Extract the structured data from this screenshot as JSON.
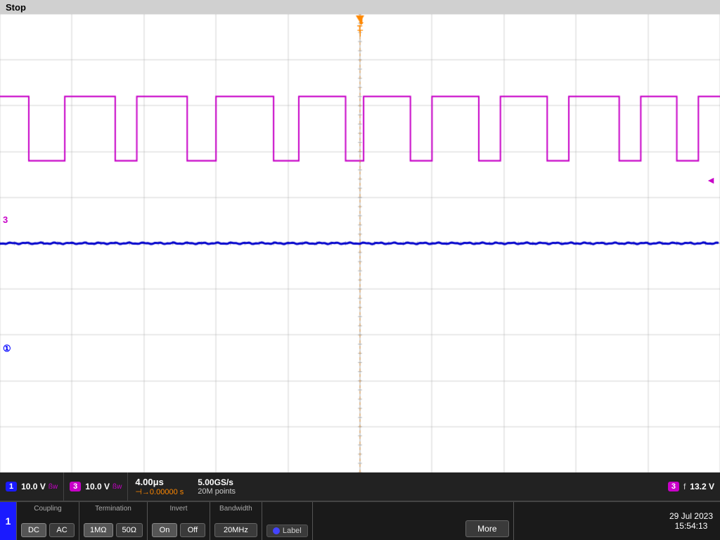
{
  "status": {
    "label": "Stop"
  },
  "channels": {
    "ch1": {
      "number": "1",
      "voltage": "10.0 V",
      "bw_symbol": "ßw"
    },
    "ch3": {
      "number": "3",
      "voltage": "10.0 V",
      "bw_symbol": "ßw",
      "measurement_label": "f",
      "measurement_value": "13.2 V"
    }
  },
  "timebase": {
    "main": "4.00μs",
    "trigger_time": "⊣→0.00000 s"
  },
  "sample_rate": {
    "rate": "5.00GS/s",
    "points": "20M points"
  },
  "controls": {
    "channel_number": "1",
    "coupling": {
      "label": "Coupling",
      "dc_label": "DC",
      "ac_label": "AC"
    },
    "termination": {
      "label": "Termination",
      "one_meg_label": "1MΩ",
      "fifty_label": "50Ω"
    },
    "invert": {
      "label": "Invert",
      "on_label": "On",
      "off_label": "Off",
      "status": "Invert On"
    },
    "bandwidth": {
      "label": "Bandwidth",
      "value": "20MHz"
    },
    "label_btn": "Label",
    "more_btn": "More"
  },
  "datetime": {
    "date": "29 Jul 2023",
    "time": "15:54:13"
  }
}
